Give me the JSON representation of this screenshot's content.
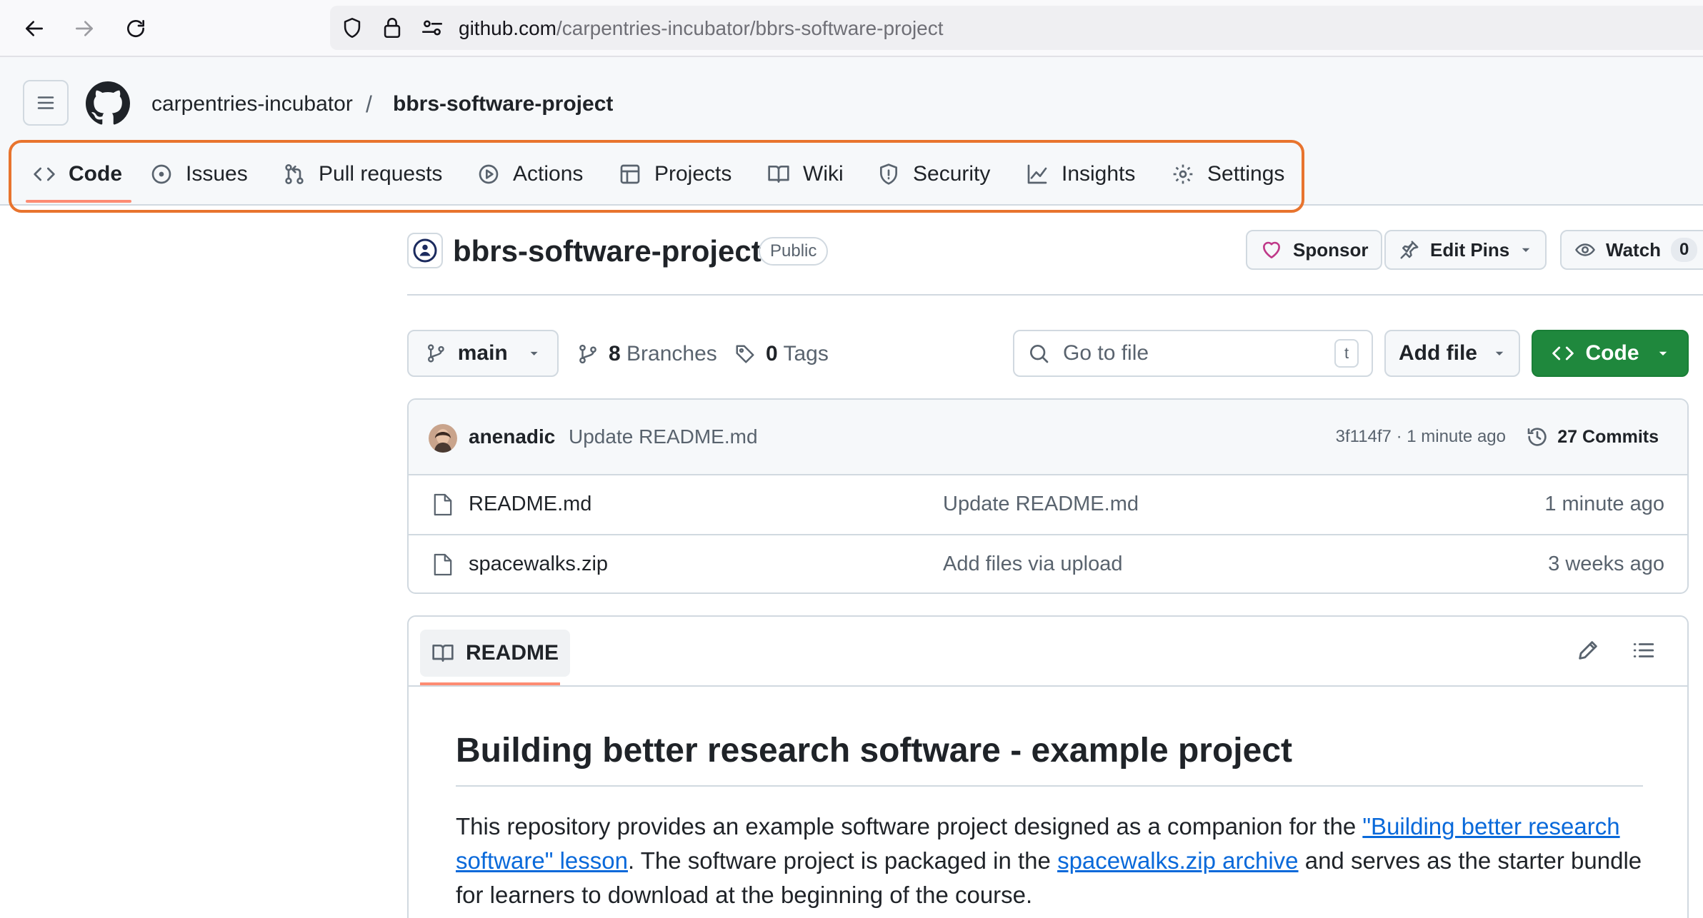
{
  "browser": {
    "url_host": "github.com",
    "url_path": "/carpentries-incubator/bbrs-software-project"
  },
  "header": {
    "owner": "carpentries-incubator",
    "separator": "/",
    "repo": "bbrs-software-project"
  },
  "tabs": [
    {
      "label": "Code",
      "icon": "code-icon",
      "active": true
    },
    {
      "label": "Issues",
      "icon": "issue-icon"
    },
    {
      "label": "Pull requests",
      "icon": "pull-request-icon"
    },
    {
      "label": "Actions",
      "icon": "play-icon"
    },
    {
      "label": "Projects",
      "icon": "table-icon"
    },
    {
      "label": "Wiki",
      "icon": "book-icon"
    },
    {
      "label": "Security",
      "icon": "shield-icon"
    },
    {
      "label": "Insights",
      "icon": "graph-icon"
    },
    {
      "label": "Settings",
      "icon": "gear-icon"
    }
  ],
  "repo_header": {
    "title": "bbrs-software-project",
    "visibility": "Public",
    "sponsor_label": "Sponsor",
    "edit_pins_label": "Edit Pins",
    "watch_label": "Watch",
    "watch_count": "0"
  },
  "toolbar": {
    "branch": "main",
    "branches_count": "8",
    "branches_label": "Branches",
    "tags_count": "0",
    "tags_label": "Tags",
    "search_placeholder": "Go to file",
    "search_shortcut": "t",
    "add_file_label": "Add file",
    "code_label": "Code"
  },
  "latest_commit": {
    "author": "anenadic",
    "message": "Update README.md",
    "meta": "3f114f7 · 1 minute ago",
    "commits_label": "27 Commits"
  },
  "files": [
    {
      "name": "README.md",
      "commit": "Update README.md",
      "time": "1 minute ago"
    },
    {
      "name": "spacewalks.zip",
      "commit": "Add files via upload",
      "time": "3 weeks ago"
    }
  ],
  "readme": {
    "tab_label": "README",
    "heading": "Building better research software - example project",
    "p_text1": "This repository provides an example software project designed as a companion for the ",
    "p_link1": "\"Building better research software\" lesson",
    "p_text2": ". The software project is packaged in the ",
    "p_link2": "spacewalks.zip archive",
    "p_text3": " and serves as the starter bundle for learners to download at the beginning of the course."
  },
  "colors": {
    "highlight": "#e8742e",
    "tab_underline": "#fd8c73",
    "code_button": "#1f883d",
    "link": "#0969da",
    "sponsor_heart": "#bf3989"
  }
}
